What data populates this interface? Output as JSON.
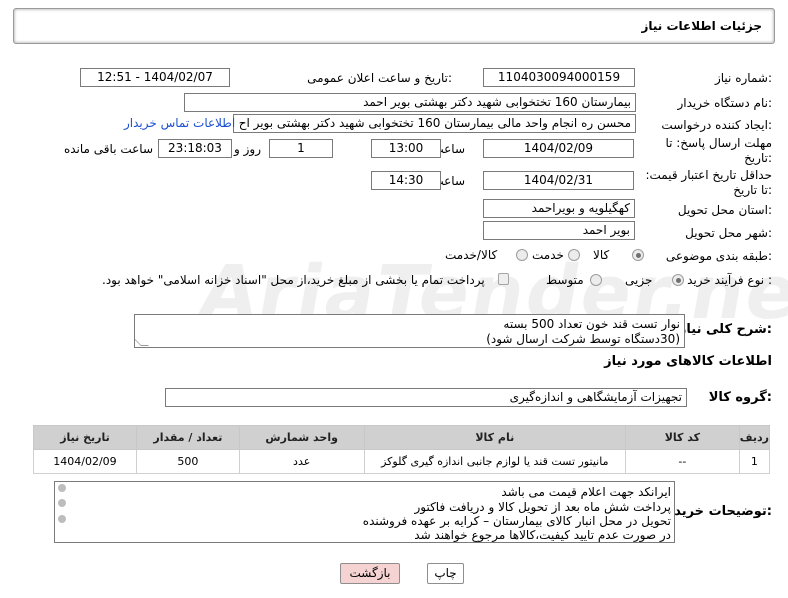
{
  "header": {
    "title": "جزئیات اطلاعات نیاز"
  },
  "form": {
    "need_number_label": "شماره نیاز:",
    "need_number": "1104030094000159",
    "announce_label": "تاریخ و ساعت اعلان عمومی:",
    "announce_value": "1404/02/07 - 12:51",
    "buyer_org_label": "نام دستگاه خریدار:",
    "buyer_org": "بیمارستان 160 تختخوابی شهید دکتر بهشتی بویر احمد",
    "requester_label": "ایجاد کننده درخواست:",
    "requester": "محسن ره انجام واحد مالی بیمارستان 160 تختخوابی شهید دکتر بهشتی بویر اح",
    "contact_link": "اطلاعات تماس خریدار",
    "reply_deadline_label": "مهلت ارسال پاسخ: تا تاریخ:",
    "reply_date": "1404/02/09",
    "time_label": "ساعت",
    "reply_time": "13:00",
    "days_value": "1",
    "days_label": "روز و",
    "remaining_time": "23:18:03",
    "remaining_label": "ساعت باقی مانده",
    "price_validity_label": "حداقل تاریخ اعتبار قیمت: تا تاریخ:",
    "price_date": "1404/02/31",
    "price_time_label": "ساعت",
    "price_time": "14:30",
    "province_label": "استان محل تحویل:",
    "province": "کهگیلویه و بویراحمد",
    "city_label": "شهر محل تحویل:",
    "city": "بویر احمد",
    "category_label": "طبقه بندی موضوعی:",
    "category_options": [
      "کالا",
      "خدمت",
      "کالا/خدمت"
    ],
    "process_label": "نوع فرآیند خرید :",
    "process_options": [
      "جزیی",
      "متوسط"
    ],
    "payment_note": "پرداخت تمام یا بخشی از مبلغ خرید،از محل \"اسناد خزانه اسلامی\" خواهد بود."
  },
  "summary": {
    "label": "شرح کلی نیاز:",
    "line1": "نوار تست قند خون تعداد 500 بسته",
    "line2": "(30دستگاه توسط شرکت ارسال شود)"
  },
  "goods": {
    "section_title": "اطلاعات کالاهای مورد نیاز",
    "group_label": "گروه کالا:",
    "group_value": "تجهیزات آزمایشگاهی و اندازه‌گیری",
    "columns": [
      "ردیف",
      "کد کالا",
      "نام کالا",
      "واحد شمارش",
      "تعداد / مقدار",
      "تاریخ نیاز"
    ],
    "rows": [
      [
        "1",
        "--",
        "مانیتور تست قند یا لوازم جانبی اندازه گیری گلوکز",
        "عدد",
        "500",
        "1404/02/09"
      ]
    ]
  },
  "buyer_notes": {
    "label": "توضیحات خریدار:",
    "lines": [
      "ایرانکد جهت اعلام قیمت می باشد",
      "پرداخت شش ماه بعد از تحویل کالا و دریافت فاکتور",
      "تحویل در محل انبار کالای بیمارستان – کرایه بر عهده فروشنده",
      "در صورت عدم تایید کیفیت،کالاها مرجوع خواهند شد"
    ]
  },
  "buttons": {
    "print": "چاپ",
    "back": "بازگشت"
  },
  "colors": {
    "link": "#1b4fd1",
    "back_button_bg": "#f6d3d3",
    "header_border": "#9a9a9a"
  }
}
